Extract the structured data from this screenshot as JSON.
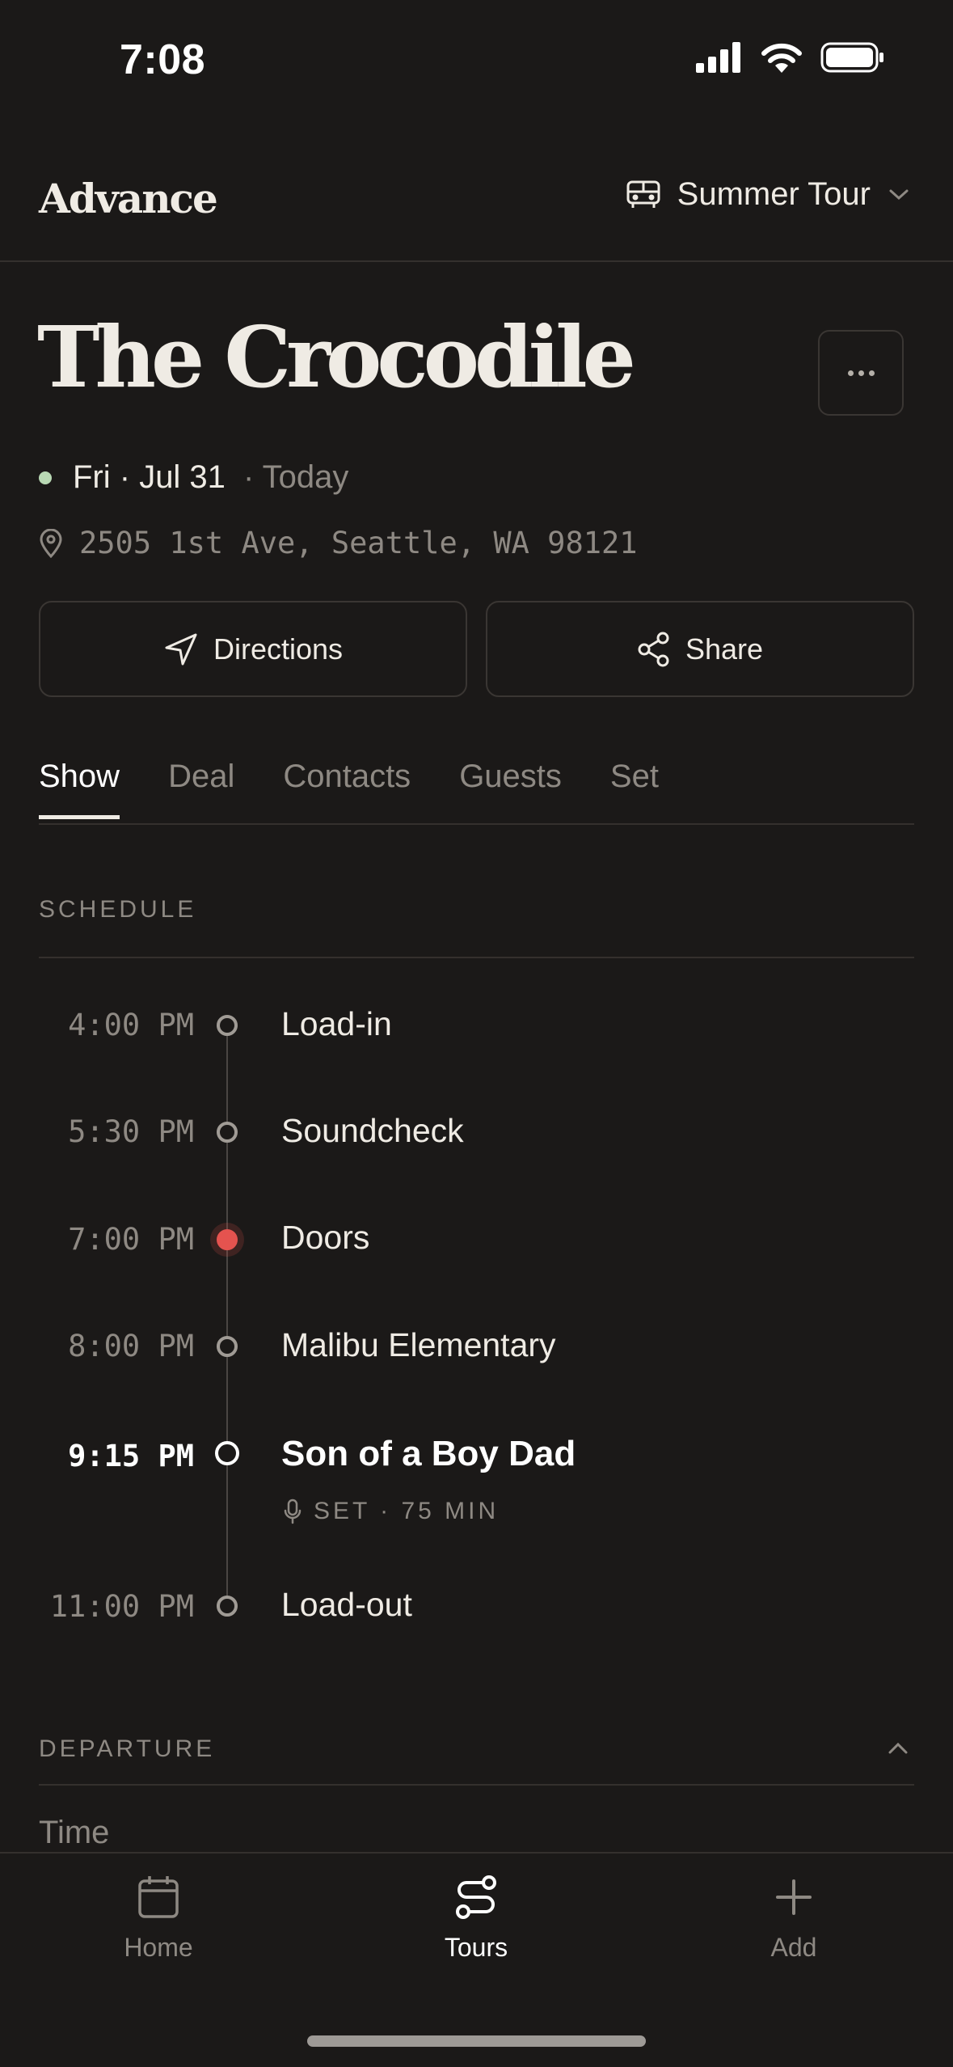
{
  "status_bar": {
    "time": "7:08"
  },
  "header": {
    "brand": "Advance",
    "tour_name": "Summer Tour"
  },
  "venue": {
    "name": "The Crocodile",
    "date": "Fri · Jul 31",
    "relative": "· Today",
    "address": "2505 1st Ave, Seattle, WA 98121"
  },
  "actions": {
    "directions": "Directions",
    "share": "Share"
  },
  "tabs": [
    "Show",
    "Deal",
    "Contacts",
    "Guests",
    "Set"
  ],
  "schedule": {
    "label": "SCHEDULE",
    "items": [
      {
        "time": "4:00 PM",
        "label": "Load-in"
      },
      {
        "time": "5:30 PM",
        "label": "Soundcheck"
      },
      {
        "time": "7:00 PM",
        "label": "Doors"
      },
      {
        "time": "8:00 PM",
        "label": "Malibu Elementary"
      },
      {
        "time": "9:15 PM",
        "label": "Son of a Boy Dad",
        "sub": "SET · 75 MIN"
      },
      {
        "time": "11:00 PM",
        "label": "Load-out"
      }
    ]
  },
  "departure": {
    "label": "DEPARTURE",
    "field_label": "Time"
  },
  "nav": {
    "home": "Home",
    "tours": "Tours",
    "add": "Add"
  },
  "colors": {
    "background": "#1b1918",
    "accent_red": "#e5534f",
    "status_green": "#b9d9b4"
  }
}
